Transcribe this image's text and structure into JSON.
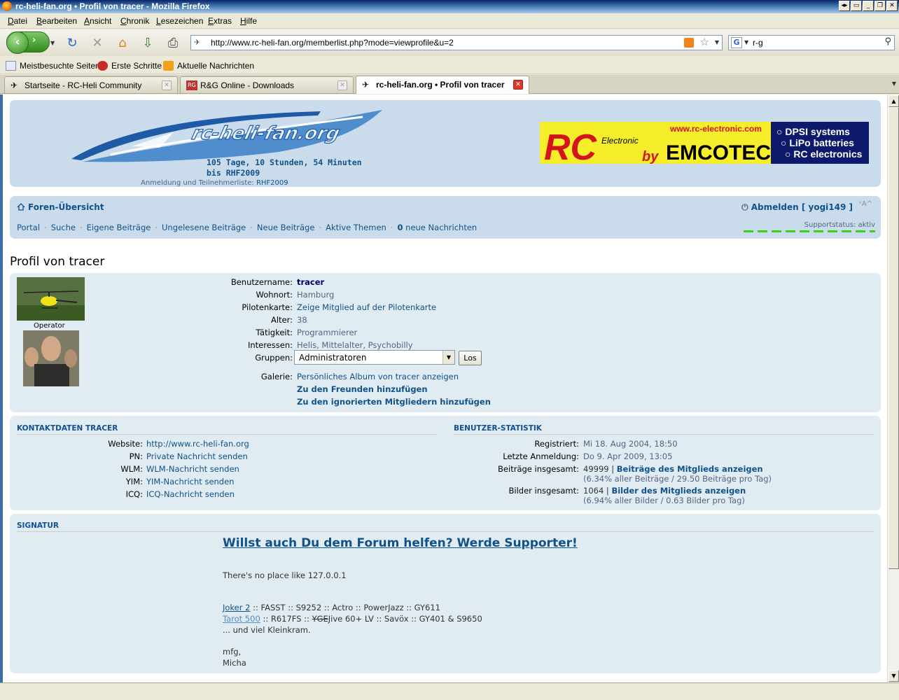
{
  "window": {
    "title": "rc-heli-fan.org • Profil von tracer - Mozilla Firefox"
  },
  "menu": [
    "Datei",
    "Bearbeiten",
    "Ansicht",
    "Chronik",
    "Lesezeichen",
    "Extras",
    "Hilfe"
  ],
  "urlbar": {
    "url": "http://www.rc-heli-fan.org/memberlist.php?mode=viewprofile&u=2"
  },
  "searchbar": {
    "value": "r-g"
  },
  "bookmarks": [
    "Meistbesuchte Seiten",
    "Erste Schritte",
    "Aktuelle Nachrichten"
  ],
  "tabs": [
    {
      "label": "Startseite - RC-Heli Community",
      "active": false
    },
    {
      "label": "R&G Online - Downloads",
      "active": false
    },
    {
      "label": "rc-heli-fan.org • Profil von tracer",
      "active": true
    }
  ],
  "header": {
    "logo_text": "rc-heli-fan.org",
    "countdown_line1": "105 Tage, 10 Stunden, 54 Minuten",
    "countdown_line2": "bis RHF2009",
    "anmeldung_label": "Anmeldung und Teilnehmerliste:",
    "anmeldung_link": "RHF2009",
    "banner": {
      "url": "www.rc-electronic.com",
      "rc": "RC",
      "electronic": "Electronic",
      "by": "by",
      "brand": "EMCOTEC",
      "lines": [
        "DPSI systems",
        "LiPo batteries",
        "RC electronics"
      ]
    }
  },
  "nav": {
    "foren": "Foren-Übersicht",
    "abmelden": "Abmelden [ yogi149 ]",
    "links": [
      "Portal",
      "Suche",
      "Eigene Beiträge",
      "Ungelesene Beiträge",
      "Neue Beiträge",
      "Aktive Themen"
    ],
    "messages_count": "0",
    "messages_label": "neue Nachrichten",
    "support_label": "Supportstatus: aktiv"
  },
  "profile": {
    "title": "Profil von tracer",
    "rank": "Operator",
    "fields": [
      {
        "label": "Benutzername:",
        "value": "tracer"
      },
      {
        "label": "Wohnort:",
        "value": "Hamburg"
      },
      {
        "label": "Pilotenkarte:",
        "value": "Zeige Mitglied auf der Pilotenkarte"
      },
      {
        "label": "Alter:",
        "value": "38"
      },
      {
        "label": "Tätigkeit:",
        "value": "Programmierer"
      },
      {
        "label": "Interessen:",
        "value": "Helis, Mittelalter, Psychobilly"
      }
    ],
    "groups_label": "Gruppen:",
    "groups_selected": "Administratoren",
    "groups_button": "Los",
    "gallery_label": "Galerie:",
    "gallery_value": "Persönliches Album von tracer anzeigen",
    "add_friend": "Zu den Freunden hinzufügen",
    "add_ignore": "Zu den ignorierten Mitgliedern hinzufügen"
  },
  "contact": {
    "heading": "Kontaktdaten tracer",
    "rows": [
      {
        "label": "Website:",
        "value": "http://www.rc-heli-fan.org"
      },
      {
        "label": "PN:",
        "value": "Private Nachricht senden"
      },
      {
        "label": "WLM:",
        "value": "WLM-Nachricht senden"
      },
      {
        "label": "YIM:",
        "value": "YIM-Nachricht senden"
      },
      {
        "label": "ICQ:",
        "value": "ICQ-Nachricht senden"
      }
    ]
  },
  "stats": {
    "heading": "Benutzer-Statistik",
    "registered_label": "Registriert:",
    "registered_value": "Mi 18. Aug 2004, 18:50",
    "lastlogin_label": "Letzte Anmeldung:",
    "lastlogin_value": "Do 9. Apr 2009, 13:05",
    "posts_label": "Beiträge insgesamt:",
    "posts_count": "49999 |",
    "posts_link": "Beiträge des Mitglieds anzeigen",
    "posts_sub": "(6.34% aller Beiträge / 29.50 Beiträge pro Tag)",
    "images_label": "Bilder insgesamt:",
    "images_count": "1064 |",
    "images_link": "Bilder des Mitglieds anzeigen",
    "images_sub": "(6.94% aller Bilder / 0.63 Bilder pro Tag)"
  },
  "signature": {
    "heading": "Signatur",
    "headline": "Willst auch Du dem Forum helfen? Werde Supporter!",
    "line_place": "There's no place like 127.0.0.1",
    "joker_link": "Joker 2",
    "joker_rest": " :: FASST :: S9252 :: Actro :: PowerJazz :: GY611",
    "tarot_link": "Tarot 500",
    "tarot_mid": " :: R617FS :: ",
    "tarot_struck": "YGE",
    "tarot_rest": "Jive 60+ LV :: Savöx :: GY401 & S9650",
    "line_more": "... und viel Kleinkram.",
    "line_mfg": "mfg,",
    "line_name": "Micha"
  }
}
